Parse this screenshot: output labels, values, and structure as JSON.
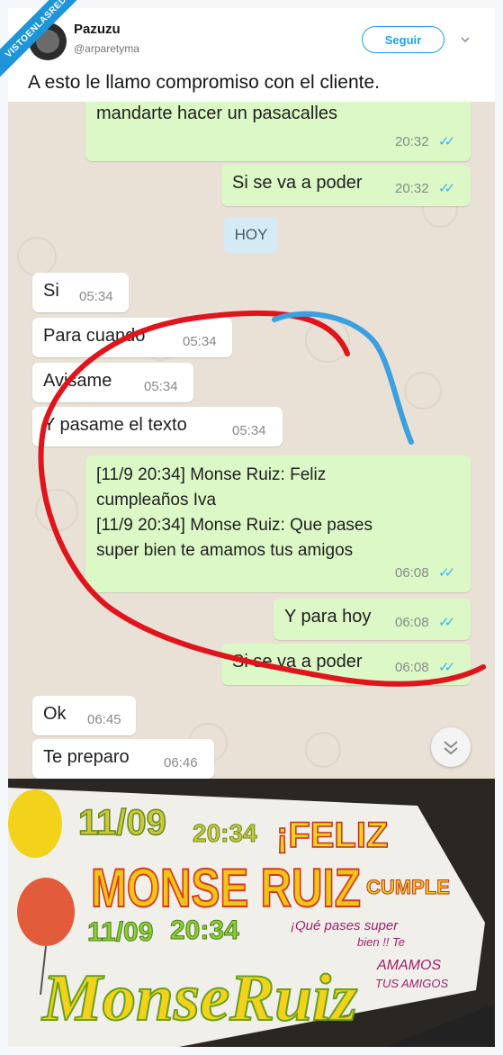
{
  "watermark": "VISTOENLASREDES",
  "tweet": {
    "author_name": "Pazuzu",
    "author_handle": "@arparetyma",
    "follow_label": "Seguir",
    "text": "A esto le llamo compromiso con el cliente."
  },
  "chat": {
    "day_label": "HOY",
    "messages": [
      {
        "dir": "out",
        "text": "mandarte hacer un pasacalles",
        "time": "20:32"
      },
      {
        "dir": "out",
        "text": "Si se va a poder",
        "time": "20:32"
      },
      {
        "dir": "in",
        "text": "Si",
        "time": "05:34"
      },
      {
        "dir": "in",
        "text": "Para cuando",
        "time": "05:34"
      },
      {
        "dir": "in",
        "text": "Avisame",
        "time": "05:34"
      },
      {
        "dir": "in",
        "text": "Y pasame el texto",
        "time": "05:34"
      },
      {
        "dir": "out",
        "lines": [
          "[11/9 20:34] Monse Ruiz: Feliz",
          "cumpleaños Iva",
          "[11/9 20:34] Monse Ruiz: Que pases",
          "super bien te amamos tus amigos"
        ],
        "time": "06:08"
      },
      {
        "dir": "out",
        "text": "Y para hoy",
        "time": "06:08"
      },
      {
        "dir": "out",
        "text": "Si se va a poder",
        "time": "06:08"
      },
      {
        "dir": "in",
        "text": "Ok",
        "time": "06:45"
      },
      {
        "dir": "in",
        "text": "Te preparo",
        "time": "06:46"
      }
    ],
    "scroll_icon": "chevron-double-down-icon"
  },
  "banner": {
    "line1_date": "11/09",
    "line1_time": "20:34",
    "line1_greeting": "¡FELIZ",
    "line2_name": "MONSE RUIZ",
    "line2_word": "CUMPLE",
    "line3_date": "11/09",
    "line3_time": "20:34",
    "line3_msg": [
      "¡Qué pases super",
      "bien !! Te",
      "AMAMOS",
      "TUS AMIGOS"
    ],
    "line4_name": "MonseRuiz"
  },
  "colors": {
    "twitter_blue": "#1da1f2",
    "outgoing_bubble": "#dcf8c6",
    "incoming_bubble": "#ffffff",
    "chat_bg": "#e9e1d6",
    "red_marker": "#e0141c",
    "blue_marker": "#3b9fe0",
    "read_ticks": "#34b7f1"
  }
}
